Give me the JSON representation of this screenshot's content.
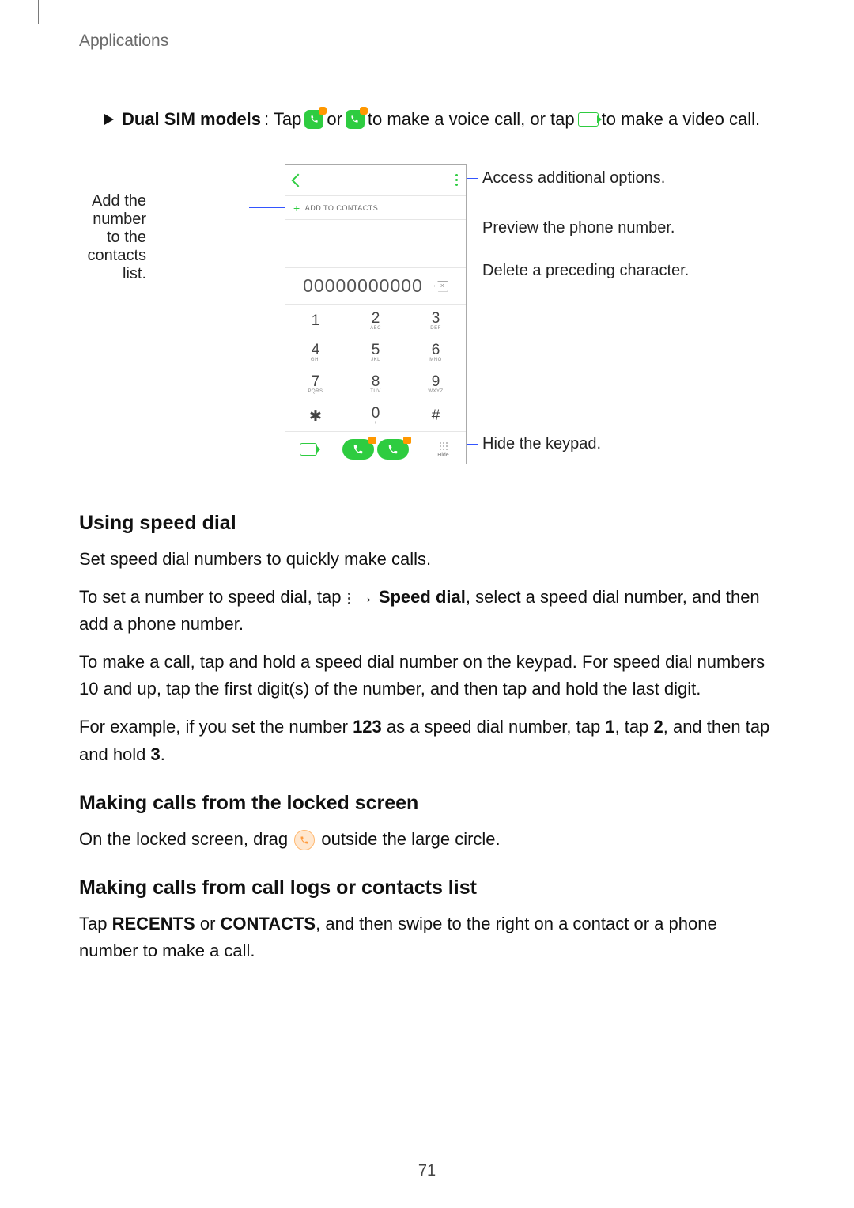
{
  "header": {
    "section": "Applications"
  },
  "bullet": {
    "label": "Dual SIM models",
    "pre": ": Tap",
    "mid": "or",
    "voice": "to make a voice call, or tap",
    "video": "to make a video call."
  },
  "labels": {
    "addContacts": "Add the number to the contacts list.",
    "moreOptions": "Access additional options.",
    "preview": "Preview the phone number.",
    "delete": "Delete a preceding character.",
    "hide": "Hide the keypad."
  },
  "phone": {
    "addToContacts": "ADD TO CONTACTS",
    "number": "00000000000",
    "keys": [
      {
        "d": "1",
        "l": ""
      },
      {
        "d": "2",
        "l": "ABC"
      },
      {
        "d": "3",
        "l": "DEF"
      },
      {
        "d": "4",
        "l": "GHI"
      },
      {
        "d": "5",
        "l": "JKL"
      },
      {
        "d": "6",
        "l": "MNO"
      },
      {
        "d": "7",
        "l": "PQRS"
      },
      {
        "d": "8",
        "l": "TUV"
      },
      {
        "d": "9",
        "l": "WXYZ"
      },
      {
        "d": "✱",
        "l": ""
      },
      {
        "d": "0",
        "l": "+"
      },
      {
        "d": "#",
        "l": ""
      }
    ],
    "hideLabel": "Hide"
  },
  "sections": {
    "speed": {
      "title": "Using speed dial",
      "p1": "Set speed dial numbers to quickly make calls.",
      "p2a": "To set a number to speed dial, tap",
      "p2arrow": "→",
      "p2bold": "Speed dial",
      "p2b": ", select a speed dial number, and then add a phone number.",
      "p3": "To make a call, tap and hold a speed dial number on the keypad. For speed dial numbers 10 and up, tap the first digit(s) of the number, and then tap and hold the last digit.",
      "p4a": "For example, if you set the number ",
      "p4n": "123",
      "p4b": " as a speed dial number, tap ",
      "p4k1": "1",
      "p4c": ", tap ",
      "p4k2": "2",
      "p4d": ", and then tap and hold ",
      "p4k3": "3",
      "p4e": "."
    },
    "locked": {
      "title": "Making calls from the locked screen",
      "p1a": "On the locked screen, drag",
      "p1b": "outside the large circle."
    },
    "logs": {
      "title": "Making calls from call logs or contacts list",
      "p1a": "Tap ",
      "p1r": "RECENTS",
      "p1b": " or ",
      "p1c": "CONTACTS",
      "p1d": ", and then swipe to the right on a contact or a phone number to make a call."
    }
  },
  "pageNumber": "71"
}
